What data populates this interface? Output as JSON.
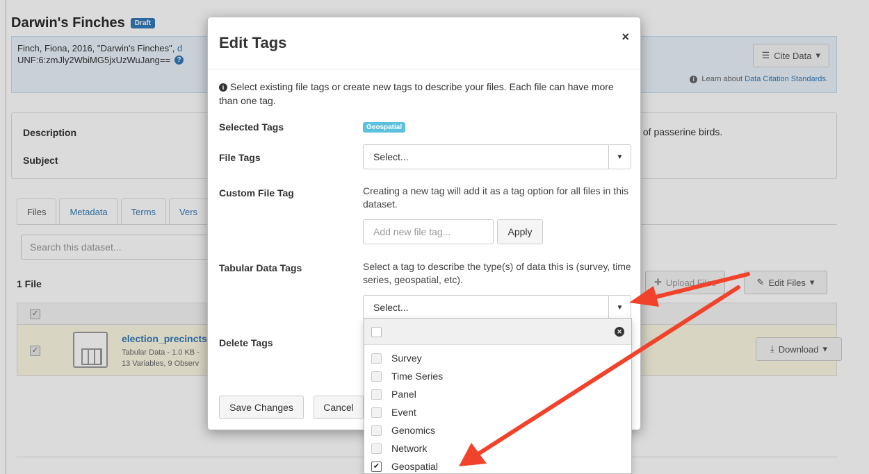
{
  "dataset": {
    "title": "Darwin's Finches",
    "badge": "Draft",
    "citation_prefix": "Finch, Fiona, 2016, \"Darwin's Finches\",",
    "citation_link": "d",
    "unf": "UNF:6:zmJly2WbiMG5jxUzWuJang==",
    "unf_help": "?",
    "cite_button": "Cite Data",
    "learn_prefix": "Learn about",
    "learn_link": "Data Citation Standards."
  },
  "metadata": {
    "description_label": "Description",
    "subject_label": "Subject",
    "description_tail": "s of passerine birds."
  },
  "tabs": [
    "Files",
    "Metadata",
    "Terms",
    "Vers"
  ],
  "files": {
    "search_placeholder": "Search this dataset...",
    "count": "1 File",
    "upload_button": "Upload Files",
    "edit_button": "Edit Files",
    "row": {
      "name": "election_precincts",
      "meta1": "Tabular Data - 1.0 KB -",
      "meta2": "13 Variables, 9 Observ",
      "download_button": "Download"
    }
  },
  "modal": {
    "title": "Edit Tags",
    "close": "×",
    "intro": "Select existing file tags or create new tags to describe your files. Each file can have more than one tag.",
    "selected_tags_label": "Selected Tags",
    "selected_tag": "Geospatial",
    "file_tags_label": "File Tags",
    "file_tags_value": "Select...",
    "custom_label": "Custom File Tag",
    "custom_help": "Creating a new tag will add it as a tag option for all files in this dataset.",
    "custom_placeholder": "Add new file tag...",
    "apply": "Apply",
    "tabular_label": "Tabular Data Tags",
    "tabular_help": "Select a tag to describe the type(s) of data this is (survey, time series, geospatial, etc).",
    "tabular_value": "Select...",
    "delete_label": "Delete Tags",
    "save": "Save Changes",
    "cancel": "Cancel"
  },
  "dropdown": {
    "options": [
      {
        "label": "Survey",
        "checked": false
      },
      {
        "label": "Time Series",
        "checked": false
      },
      {
        "label": "Panel",
        "checked": false
      },
      {
        "label": "Event",
        "checked": false
      },
      {
        "label": "Genomics",
        "checked": false
      },
      {
        "label": "Network",
        "checked": false
      },
      {
        "label": "Geospatial",
        "checked": true
      }
    ]
  },
  "colors": {
    "accent": "#337ab7",
    "info_label": "#5bc0de",
    "annotation_arrow": "#f1432b"
  }
}
